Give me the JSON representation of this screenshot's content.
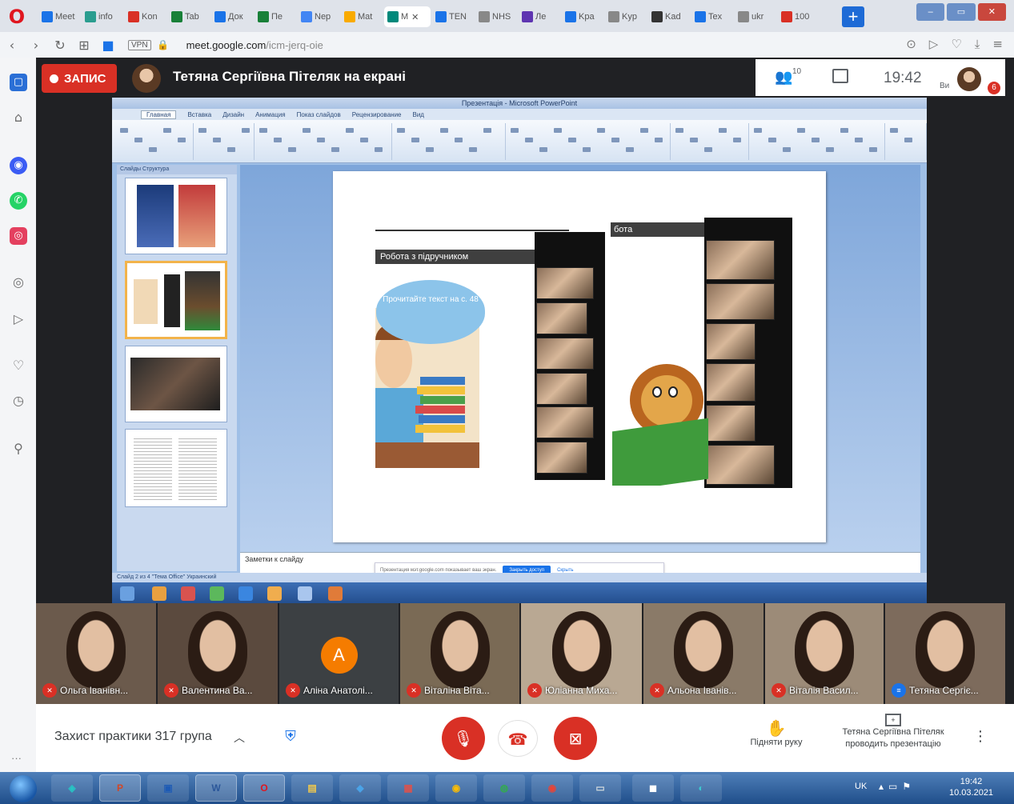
{
  "browser": {
    "tabs": [
      {
        "label": "Meet",
        "color": "#1a73e8"
      },
      {
        "label": "info",
        "color": "#2a9d8f"
      },
      {
        "label": "Kon",
        "color": "#d93025"
      },
      {
        "label": "Tab",
        "color": "#188038"
      },
      {
        "label": "Док",
        "color": "#1a73e8"
      },
      {
        "label": "Пе",
        "color": "#188038"
      },
      {
        "label": "Nep",
        "color": "#4285f4"
      },
      {
        "label": "Mat",
        "color": "#f9ab00"
      },
      {
        "label": "M",
        "color": "#00897b",
        "active": true
      },
      {
        "label": "TEN",
        "color": "#1a73e8"
      },
      {
        "label": "NHS",
        "color": "#888888"
      },
      {
        "label": "Лe",
        "color": "#5e35b1"
      },
      {
        "label": "Kpa",
        "color": "#1a73e8"
      },
      {
        "label": "Kyp",
        "color": "#888888"
      },
      {
        "label": "Kad",
        "color": "#333333"
      },
      {
        "label": "Tex",
        "color": "#1a73e8"
      },
      {
        "label": "ukr",
        "color": "#888888"
      },
      {
        "label": "100",
        "color": "#d93025"
      }
    ],
    "new_tab": "+",
    "url_host": "meet.google.com",
    "url_path": "/icm-jerq-oie",
    "vpn": "VPN"
  },
  "meet": {
    "recording_label": "ЗАПИС",
    "presenter_title": "Тетяна Сергіївна Пітеляк на екрані",
    "people_count": "10",
    "time": "19:42",
    "you_label": "Ви",
    "notifications": "6",
    "meeting_name": "Захист практики 317 група",
    "raise_hand": "Підняти руку",
    "presenting_line1": "Тетяна Сергіївна Пітеляк",
    "presenting_line2": "проводить презентацію"
  },
  "ppt": {
    "title": "Презентація - Microsoft PowerPoint",
    "tabs": [
      "Главная",
      "Вставка",
      "Дизайн",
      "Анимация",
      "Показ слайдов",
      "Рецензирование",
      "Вид"
    ],
    "panel_tabs": "Слайды  Структура",
    "notes_label": "Заметки к слайду",
    "status": "Слайд 2 из 4   \"Тема Office\"   Украинский",
    "share_text": "Презентация мэт.google.com показывает ваш экран.",
    "share_stop": "Закрыть доступ",
    "share_hide": "Скрыть"
  },
  "slide": {
    "label_left": "Робота з підручником",
    "label_right": "бота",
    "cloud_text": "Прочитайте текст на с. 48"
  },
  "participants": [
    {
      "name": "Ольга Іванівн...",
      "muted": true
    },
    {
      "name": "Валентина Ва...",
      "muted": true
    },
    {
      "name": "Аліна Анатолі...",
      "muted": true,
      "letter": "A"
    },
    {
      "name": "Віталіна Віта...",
      "muted": true
    },
    {
      "name": "Юліанна Миха...",
      "muted": true
    },
    {
      "name": "Альона Іванів...",
      "muted": true
    },
    {
      "name": "Віталія Васил...",
      "muted": true
    },
    {
      "name": "Тетяна Сергіє...",
      "muted": false
    }
  ],
  "taskbar": {
    "lang": "UK",
    "time": "19:42",
    "date": "10.03.2021"
  },
  "colors": {
    "meet_dark": "#202124",
    "record_red": "#d93025",
    "meet_blue": "#1a73e8"
  }
}
